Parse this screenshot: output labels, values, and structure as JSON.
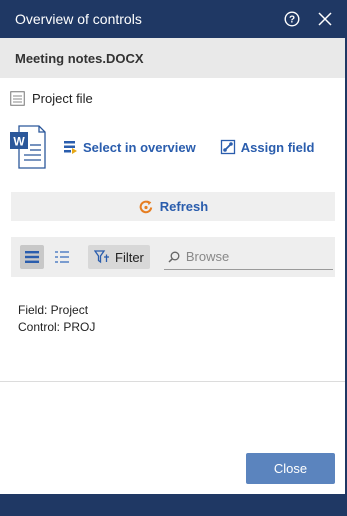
{
  "window": {
    "title": "Overview of controls",
    "help_icon": "help-circle-icon",
    "close_icon": "close-icon"
  },
  "document": {
    "name": "Meeting notes.DOCX",
    "file_icon": "word-document-icon"
  },
  "project_file": {
    "label": "Project file",
    "icon": "form-icon"
  },
  "actions": {
    "select_in_overview": "Select in overview",
    "assign_field": "Assign field"
  },
  "refresh": {
    "label": "Refresh",
    "icon": "refresh-icon"
  },
  "toolbar": {
    "filter_label": "Filter",
    "search_placeholder": "Browse",
    "list_view_icon": "list-view-icon",
    "detail_view_icon": "detail-view-icon"
  },
  "info": {
    "field": "Field: Project",
    "control": "Control: PROJ"
  },
  "footer": {
    "close_label": "Close"
  },
  "colors": {
    "header": "#1f3864",
    "accent": "#2a5dad",
    "primary_button": "#5b84be",
    "refresh_icon": "#e67e22"
  }
}
